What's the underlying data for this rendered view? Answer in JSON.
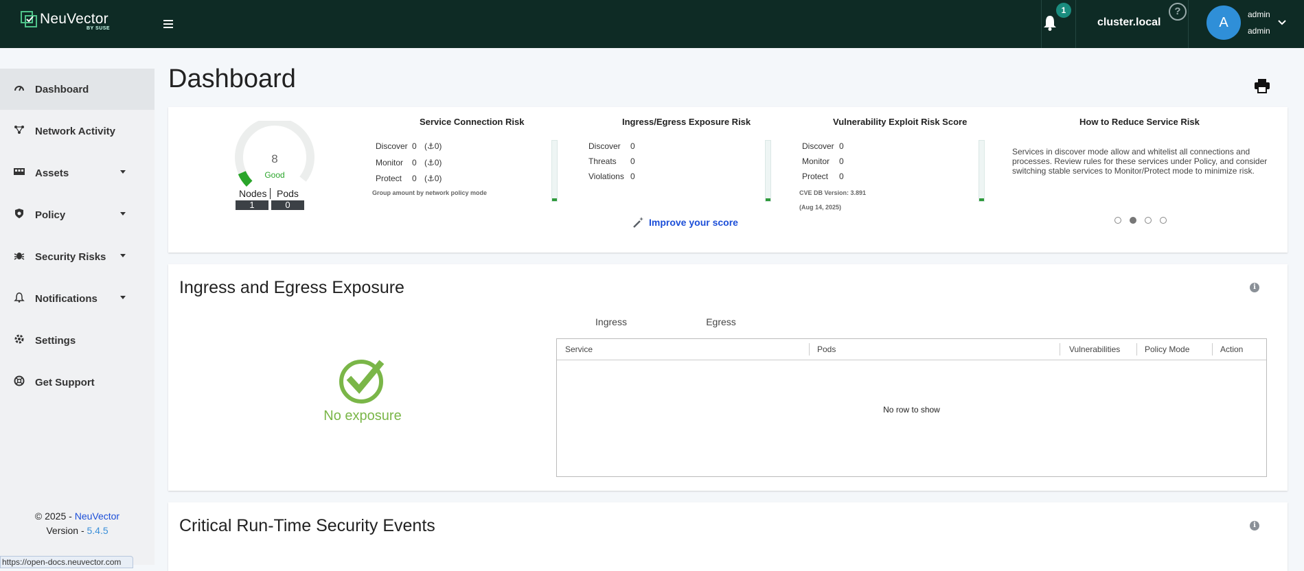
{
  "brand": {
    "name": "NeuVector",
    "sub": "BY SUSE"
  },
  "topbar": {
    "notification_count": "1",
    "cluster": "cluster.local",
    "help_glyph": "?",
    "avatar_initial": "A",
    "user_name": "admin",
    "user_role": "admin"
  },
  "sidebar": {
    "items": [
      {
        "label": "Dashboard",
        "icon": "gauge-icon"
      },
      {
        "label": "Network Activity",
        "icon": "network-icon"
      },
      {
        "label": "Assets",
        "icon": "assets-icon"
      },
      {
        "label": "Policy",
        "icon": "shield-icon"
      },
      {
        "label": "Security Risks",
        "icon": "bug-icon"
      },
      {
        "label": "Notifications",
        "icon": "bell-icon"
      },
      {
        "label": "Settings",
        "icon": "gear-icon"
      },
      {
        "label": "Get Support",
        "icon": "lifebuoy-icon"
      }
    ],
    "copyright_prefix": "© 2025 - ",
    "copyright_link": "NeuVector",
    "version_prefix": "Version - ",
    "version": "5.4.5"
  },
  "status_url": "https://open-docs.neuvector.com",
  "page": {
    "title": "Dashboard"
  },
  "risk": {
    "score": "8",
    "score_label": "Good",
    "score_fraction": 0.08,
    "nodes_label": "Nodes",
    "pods_label": "Pods",
    "nodes": "1",
    "pods": "0",
    "service_connection": {
      "title": "Service Connection Risk",
      "rows": [
        {
          "label": "Discover",
          "value": "0",
          "extra": "(⚓0)"
        },
        {
          "label": "Monitor",
          "value": "0",
          "extra": "(⚓0)"
        },
        {
          "label": "Protect",
          "value": "0",
          "extra": "(⚓0)"
        }
      ],
      "note": "Group amount by network policy mode"
    },
    "ingress_egress": {
      "title": "Ingress/Egress Exposure Risk",
      "rows": [
        {
          "label": "Discover",
          "value": "0"
        },
        {
          "label": "Threats",
          "value": "0"
        },
        {
          "label": "Violations",
          "value": "0"
        }
      ]
    },
    "vulnerability": {
      "title": "Vulnerability Exploit Risk Score",
      "rows": [
        {
          "label": "Discover",
          "value": "0"
        },
        {
          "label": "Monitor",
          "value": "0"
        },
        {
          "label": "Protect",
          "value": "0"
        }
      ],
      "cve_version": "CVE DB Version: 3.891",
      "cve_date": "(Aug 14, 2025)"
    },
    "improve_label": "Improve your score",
    "tips": {
      "title": "How to Reduce Service Risk",
      "text": "Services in discover mode allow and whitelist all connections and processes. Review rules for these services under Policy, and consider switching stable services to Monitor/Protect mode to minimize risk.",
      "active_index": 1,
      "count": 4
    }
  },
  "ingress_section": {
    "title": "Ingress and Egress Exposure",
    "no_exposure": "No exposure",
    "tabs": [
      "Ingress",
      "Egress"
    ],
    "columns": [
      "Service",
      "Pods",
      "Vulnerabilities",
      "Policy Mode",
      "Action"
    ],
    "empty_text": "No row to show"
  },
  "critical_section": {
    "title": "Critical Run-Time Security Events"
  },
  "colors": {
    "topbar": "#0e2b25",
    "accent": "#1a7a70",
    "good": "#2aa52a",
    "link": "#1b4ed8"
  }
}
